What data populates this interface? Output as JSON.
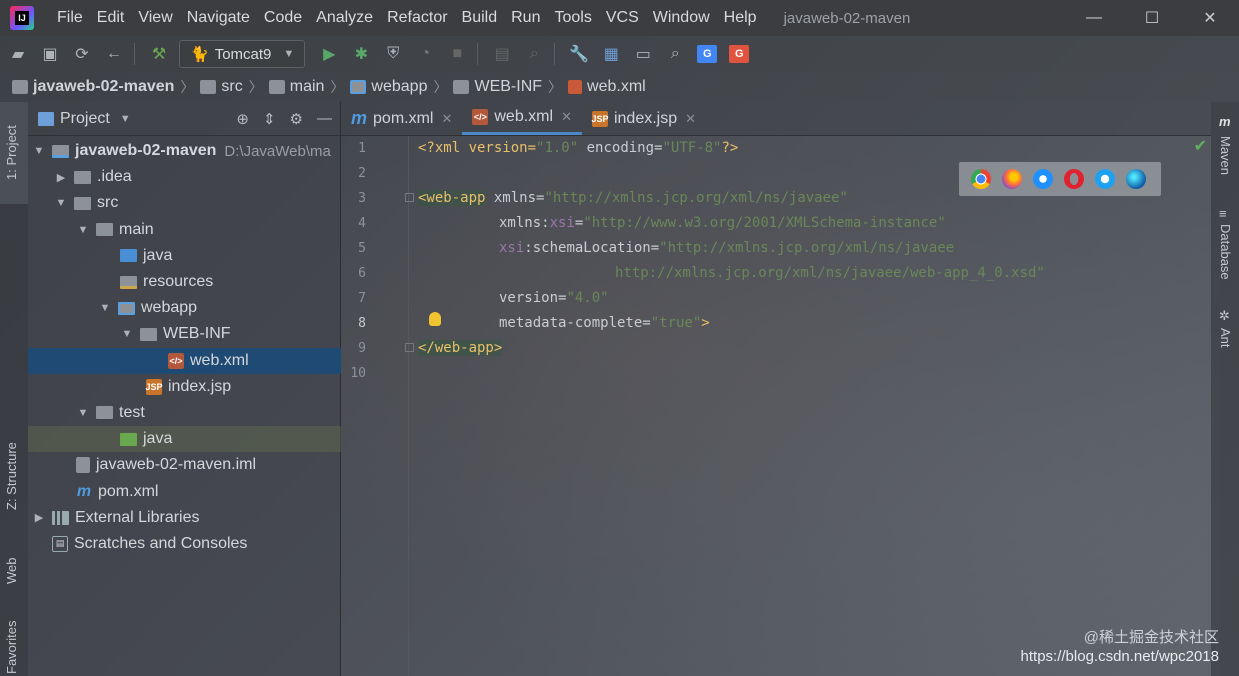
{
  "window": {
    "title": "javaweb-02-maven",
    "controls": [
      "—",
      "☐",
      "✕"
    ]
  },
  "menu": [
    "File",
    "Edit",
    "View",
    "Navigate",
    "Code",
    "Analyze",
    "Refactor",
    "Build",
    "Run",
    "Tools",
    "VCS",
    "Window",
    "Help"
  ],
  "toolbar": {
    "run_config": "Tomcat9"
  },
  "breadcrumbs": [
    "javaweb-02-maven",
    "src",
    "main",
    "webapp",
    "WEB-INF",
    "web.xml"
  ],
  "left_stripe": {
    "project_tab": "1: Project",
    "structure_tab": "Z: Structure",
    "web_tab": "Web",
    "favorites_tab": "Favorites"
  },
  "project_panel": {
    "title": "Project",
    "tree": [
      {
        "label": "javaweb-02-maven",
        "hint": "D:\\JavaWeb\\ma"
      },
      {
        "label": ".idea"
      },
      {
        "label": "src"
      },
      {
        "label": "main"
      },
      {
        "label": "java"
      },
      {
        "label": "resources"
      },
      {
        "label": "webapp"
      },
      {
        "label": "WEB-INF"
      },
      {
        "label": "web.xml"
      },
      {
        "label": "index.jsp"
      },
      {
        "label": "test"
      },
      {
        "label": "java"
      },
      {
        "label": "javaweb-02-maven.iml"
      },
      {
        "label": "pom.xml"
      },
      {
        "label": "External Libraries"
      },
      {
        "label": "Scratches and Consoles"
      }
    ]
  },
  "editor": {
    "tabs": [
      "pom.xml",
      "web.xml",
      "index.jsp"
    ],
    "active_tab": "web.xml",
    "line_numbers": [
      "1",
      "2",
      "3",
      "4",
      "5",
      "6",
      "7",
      "8",
      "9",
      "10"
    ],
    "code": {
      "l1a": "<?xml version=",
      "l1b": "\"1.0\"",
      "l1c": " encoding=",
      "l1d": "\"UTF-8\"",
      "l1e": "?>",
      "l3a": "<web-app",
      "l3b": " xmlns=",
      "l3c": "\"http://xmlns.jcp.org/xml/ns/javaee\"",
      "l4a": "xmlns:",
      "l4b": "xsi",
      "l4c": "=",
      "l4d": "\"http://www.w3.org/2001/XMLSchema-instance\"",
      "l5a": "xsi",
      "l5b": ":schemaLocation=",
      "l5c": "\"http://xmlns.jcp.org/xml/ns/javaee",
      "l6a": "http://xmlns.jcp.org/xml/ns/javaee/web-app_4_0.xsd\"",
      "l7a": "version=",
      "l7b": "\"4.0\"",
      "l8a": "metadata-complete=",
      "l8b": "\"true\"",
      "l8c": ">",
      "l9a": "</web-app>"
    }
  },
  "right_stripe": {
    "maven": "Maven",
    "database": "Database",
    "ant": "Ant"
  },
  "watermark": {
    "line1": "@稀土掘金技术社区",
    "line2": "https://blog.csdn.net/wpc2018"
  },
  "colors": {
    "accent": "#4a88c7",
    "selection": "#1f4a73",
    "xml_tag": "#e8bf6a",
    "xml_value": "#6a8759",
    "xml_ns": "#9876aa"
  }
}
